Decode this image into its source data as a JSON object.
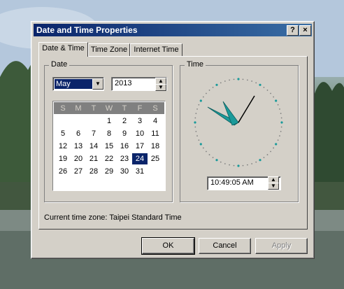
{
  "window": {
    "title": "Date and Time Properties",
    "help_label": "?",
    "close_label": "×"
  },
  "tabs": [
    {
      "label": "Date & Time",
      "active": true
    },
    {
      "label": "Time Zone",
      "active": false
    },
    {
      "label": "Internet Time",
      "active": false
    }
  ],
  "date": {
    "group_label": "Date",
    "month": "May",
    "year": "2013",
    "weekdays": [
      "S",
      "M",
      "T",
      "W",
      "T",
      "F",
      "S"
    ],
    "weeks": [
      [
        "",
        "",
        "",
        "1",
        "2",
        "3",
        "4"
      ],
      [
        "5",
        "6",
        "7",
        "8",
        "9",
        "10",
        "11"
      ],
      [
        "12",
        "13",
        "14",
        "15",
        "16",
        "17",
        "18"
      ],
      [
        "19",
        "20",
        "21",
        "22",
        "23",
        "24",
        "25"
      ],
      [
        "26",
        "27",
        "28",
        "29",
        "30",
        "31",
        ""
      ]
    ],
    "selected_day": "24"
  },
  "time": {
    "group_label": "Time",
    "value": "10:49:05 AM"
  },
  "timezone_text": "Current time zone:  Taipei Standard Time",
  "buttons": {
    "ok": "OK",
    "cancel": "Cancel",
    "apply": "Apply"
  },
  "colors": {
    "annotation_arrow": "#e8242b",
    "title_bar": "#0a246a",
    "clock_hands": "#1a9a9a"
  },
  "icons": {
    "annotation": "red-arrow-left"
  }
}
